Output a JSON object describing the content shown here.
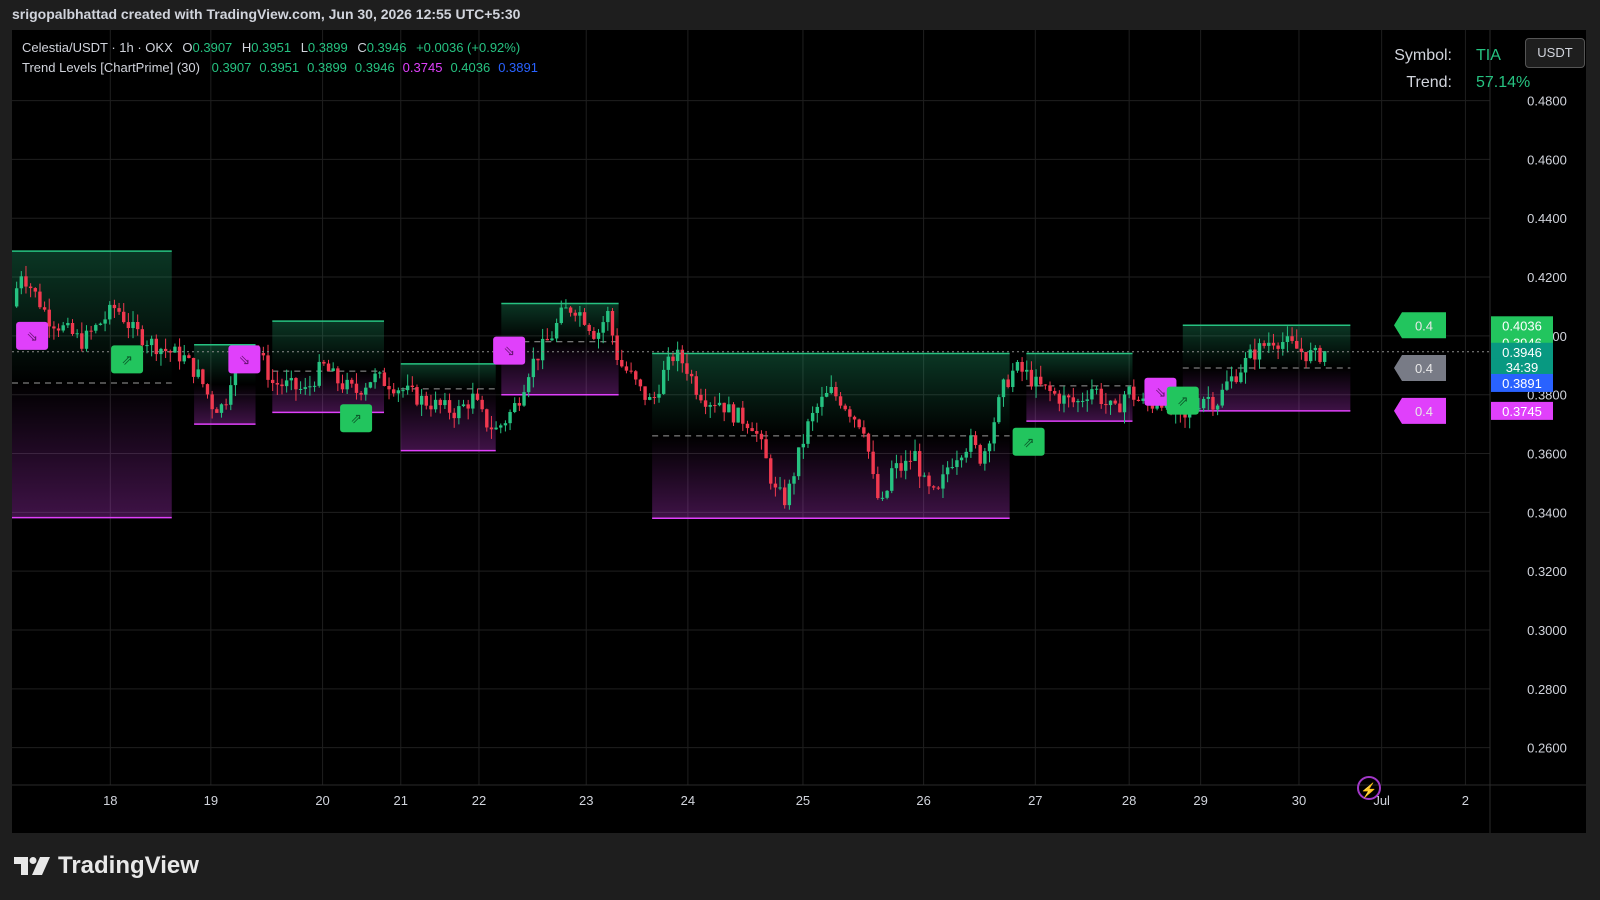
{
  "header": {
    "attribution": "srigopalbhattad created with TradingView.com, Jun 30, 2026 12:55 UTC+5:30"
  },
  "legend": {
    "symbol_line": "Celestia/USDT · 1h · OKX",
    "open_label": "O",
    "open": "0.3907",
    "high_label": "H",
    "high": "0.3951",
    "low_label": "L",
    "low": "0.3899",
    "close_label": "C",
    "close": "0.3946",
    "change": "+0.0036 (+0.92%)",
    "indicator_name": "Trend Levels [ChartPrime] (30)",
    "indicator_values": [
      {
        "value": "0.3907",
        "color": "#26c281"
      },
      {
        "value": "0.3951",
        "color": "#26c281"
      },
      {
        "value": "0.3899",
        "color": "#26c281"
      },
      {
        "value": "0.3946",
        "color": "#26c281"
      },
      {
        "value": "0.3745",
        "color": "#e040fb"
      },
      {
        "value": "0.4036",
        "color": "#26c281"
      },
      {
        "value": "0.3891",
        "color": "#2962ff"
      }
    ]
  },
  "info_panel": {
    "symbol_label": "Symbol:",
    "symbol_value": "TIA",
    "trend_label": "Trend:",
    "trend_value": "57.14%"
  },
  "currency_button": "USDT",
  "logo_text": "TradingView",
  "colors": {
    "bull": "#26c281",
    "bear": "#f0394f",
    "magenta": "#e040fb",
    "blue": "#2962ff",
    "grey": "#787b86",
    "background": "#000000"
  },
  "chart_data": {
    "type": "candlestick",
    "symbol": "Celestia/USDT",
    "interval": "1h",
    "exchange": "OKX",
    "y_ticks": [
      "0.2600",
      "0.2800",
      "0.3000",
      "0.3200",
      "0.3400",
      "0.3600",
      "0.3800",
      "0.4000",
      "0.4200",
      "0.4400",
      "0.4600",
      "0.4800"
    ],
    "ylim": [
      0.2473,
      0.504
    ],
    "x_ticks": [
      {
        "label": "18",
        "day": 17.7
      },
      {
        "label": "19",
        "day": 18.6
      },
      {
        "label": "20",
        "day": 19.6
      },
      {
        "label": "21",
        "day": 20.3
      },
      {
        "label": "22",
        "day": 21.0
      },
      {
        "label": "23",
        "day": 21.96
      },
      {
        "label": "24",
        "day": 22.87
      },
      {
        "label": "25",
        "day": 23.9
      },
      {
        "label": "26",
        "day": 24.98
      },
      {
        "label": "27",
        "day": 25.98
      },
      {
        "label": "28",
        "day": 26.82
      },
      {
        "label": "29",
        "day": 27.46
      },
      {
        "label": "30",
        "day": 28.34
      },
      {
        "label": "Jul",
        "day": 29.08
      },
      {
        "label": "2",
        "day": 29.83
      }
    ],
    "xlim": [
      16.82,
      30.05
    ],
    "price_path": [
      [
        16.82,
        0.41
      ],
      [
        16.9,
        0.422
      ],
      [
        17.0,
        0.416
      ],
      [
        17.15,
        0.406
      ],
      [
        17.3,
        0.402
      ],
      [
        17.45,
        0.398
      ],
      [
        17.6,
        0.404
      ],
      [
        17.75,
        0.41
      ],
      [
        17.9,
        0.402
      ],
      [
        18.05,
        0.398
      ],
      [
        18.2,
        0.395
      ],
      [
        18.35,
        0.393
      ],
      [
        18.5,
        0.386
      ],
      [
        18.62,
        0.376
      ],
      [
        18.72,
        0.376
      ],
      [
        18.8,
        0.39
      ],
      [
        18.9,
        0.393
      ],
      [
        19.0,
        0.397
      ],
      [
        19.15,
        0.384
      ],
      [
        19.3,
        0.383
      ],
      [
        19.45,
        0.381
      ],
      [
        19.6,
        0.39
      ],
      [
        19.75,
        0.384
      ],
      [
        19.9,
        0.381
      ],
      [
        20.05,
        0.386
      ],
      [
        20.2,
        0.384
      ],
      [
        20.35,
        0.381
      ],
      [
        20.5,
        0.378
      ],
      [
        20.65,
        0.376
      ],
      [
        20.8,
        0.374
      ],
      [
        20.95,
        0.379
      ],
      [
        21.05,
        0.371
      ],
      [
        21.15,
        0.368
      ],
      [
        21.25,
        0.372
      ],
      [
        21.35,
        0.378
      ],
      [
        21.45,
        0.389
      ],
      [
        21.55,
        0.395
      ],
      [
        21.65,
        0.4
      ],
      [
        21.75,
        0.408
      ],
      [
        21.85,
        0.41
      ],
      [
        21.95,
        0.406
      ],
      [
        22.05,
        0.4
      ],
      [
        22.15,
        0.408
      ],
      [
        22.25,
        0.391
      ],
      [
        22.35,
        0.387
      ],
      [
        22.45,
        0.381
      ],
      [
        22.55,
        0.377
      ],
      [
        22.65,
        0.387
      ],
      [
        22.75,
        0.394
      ],
      [
        22.85,
        0.39
      ],
      [
        22.95,
        0.382
      ],
      [
        23.05,
        0.378
      ],
      [
        23.15,
        0.378
      ],
      [
        23.25,
        0.374
      ],
      [
        23.35,
        0.372
      ],
      [
        23.45,
        0.37
      ],
      [
        23.55,
        0.36
      ],
      [
        23.65,
        0.347
      ],
      [
        23.75,
        0.344
      ],
      [
        23.85,
        0.358
      ],
      [
        23.95,
        0.37
      ],
      [
        24.05,
        0.377
      ],
      [
        24.15,
        0.381
      ],
      [
        24.25,
        0.378
      ],
      [
        24.35,
        0.373
      ],
      [
        24.45,
        0.369
      ],
      [
        24.55,
        0.346
      ],
      [
        24.62,
        0.342
      ],
      [
        24.7,
        0.355
      ],
      [
        24.8,
        0.355
      ],
      [
        24.9,
        0.36
      ],
      [
        25.0,
        0.348
      ],
      [
        25.1,
        0.345
      ],
      [
        25.2,
        0.356
      ],
      [
        25.3,
        0.361
      ],
      [
        25.4,
        0.364
      ],
      [
        25.5,
        0.358
      ],
      [
        25.6,
        0.37
      ],
      [
        25.7,
        0.383
      ],
      [
        25.8,
        0.389
      ],
      [
        25.9,
        0.387
      ],
      [
        26.0,
        0.383
      ],
      [
        26.1,
        0.381
      ],
      [
        26.2,
        0.379
      ],
      [
        26.35,
        0.377
      ],
      [
        26.5,
        0.383
      ],
      [
        26.6,
        0.377
      ],
      [
        26.7,
        0.374
      ],
      [
        26.8,
        0.382
      ],
      [
        26.9,
        0.378
      ],
      [
        27.0,
        0.376
      ],
      [
        27.1,
        0.379
      ],
      [
        27.2,
        0.374
      ],
      [
        27.3,
        0.37
      ],
      [
        27.4,
        0.376
      ],
      [
        27.5,
        0.38
      ],
      [
        27.6,
        0.377
      ],
      [
        27.7,
        0.384
      ],
      [
        27.8,
        0.388
      ],
      [
        27.9,
        0.393
      ],
      [
        28.0,
        0.396
      ],
      [
        28.1,
        0.399
      ],
      [
        28.2,
        0.398
      ],
      [
        28.3,
        0.396
      ],
      [
        28.4,
        0.394
      ],
      [
        28.5,
        0.393
      ],
      [
        28.58,
        0.395
      ]
    ],
    "trend_levels": [
      {
        "x0": 16.82,
        "x1": 18.25,
        "upper": 0.4288,
        "lower": 0.3382,
        "mid": 0.384
      },
      {
        "x0": 18.45,
        "x1": 19.0,
        "upper": 0.397,
        "lower": 0.37,
        "mid": null
      },
      {
        "x0": 19.15,
        "x1": 20.15,
        "upper": 0.405,
        "lower": 0.374,
        "mid": 0.388
      },
      {
        "x0": 20.3,
        "x1": 21.15,
        "upper": 0.3905,
        "lower": 0.361,
        "mid": 0.382
      },
      {
        "x0": 21.2,
        "x1": 22.25,
        "upper": 0.411,
        "lower": 0.38,
        "mid": 0.398
      },
      {
        "x0": 22.55,
        "x1": 25.75,
        "upper": 0.394,
        "lower": 0.338,
        "mid": 0.366
      },
      {
        "x0": 25.9,
        "x1": 26.85,
        "upper": 0.394,
        "lower": 0.371,
        "mid": 0.383
      },
      {
        "x0": 27.3,
        "x1": 28.8,
        "upper": 0.4036,
        "lower": 0.3745,
        "mid": 0.3891
      }
    ],
    "signals": [
      {
        "day": 17.0,
        "type": "bear",
        "price": 0.4
      },
      {
        "day": 17.85,
        "type": "bull",
        "price": 0.392
      },
      {
        "day": 18.9,
        "type": "bear",
        "price": 0.392
      },
      {
        "day": 19.9,
        "type": "bull",
        "price": 0.372
      },
      {
        "day": 21.27,
        "type": "bear",
        "price": 0.395
      },
      {
        "day": 25.92,
        "type": "bull",
        "price": 0.364
      },
      {
        "day": 27.1,
        "type": "bear",
        "price": 0.381
      },
      {
        "day": 27.3,
        "type": "bull",
        "price": 0.378
      }
    ],
    "right_labels": [
      {
        "text": "0.4",
        "price": 0.4036,
        "color": "#22c55e"
      },
      {
        "text": "0.4",
        "price": 0.3891,
        "color": "#787b86"
      },
      {
        "text": "0.4",
        "price": 0.3745,
        "color": "#e040fb"
      }
    ],
    "axis_badges": [
      {
        "text": "0.4036",
        "price": 0.4036,
        "color": "#22c55e"
      },
      {
        "text": "0.3946",
        "price": 0.3978,
        "color": "#22c55e"
      },
      {
        "text": "0.3946",
        "price": 0.3946,
        "color": "#089981"
      },
      {
        "text": "34:39",
        "price": 0.3894,
        "color": "#089981"
      },
      {
        "text": "0.3891",
        "price": 0.384,
        "color": "#2962ff"
      },
      {
        "text": "0.3745",
        "price": 0.3745,
        "color": "#e040fb"
      }
    ],
    "current_price": 0.3946
  }
}
